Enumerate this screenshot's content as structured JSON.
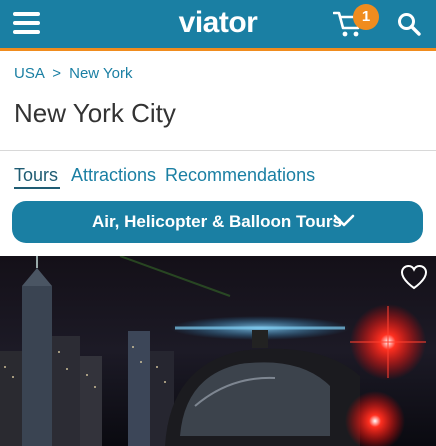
{
  "header": {
    "logo_text": "viator",
    "cart_count": "1",
    "brand_color": "#1a7fa3",
    "accent_color": "#f08c1e",
    "icons": [
      "hamburger-menu-icon",
      "cart-icon",
      "search-icon"
    ]
  },
  "breadcrumb": {
    "items": [
      "USA",
      "New York"
    ],
    "separator": ">"
  },
  "page": {
    "title": "New York City"
  },
  "tabs": [
    {
      "label": "Tours",
      "active": true
    },
    {
      "label": "Attractions",
      "active": false
    },
    {
      "label": "Recommendations",
      "active": false
    }
  ],
  "category": {
    "label": "Air, Helicopter & Balloon Tours",
    "icon": "chevron-down-icon"
  },
  "hero": {
    "favorite_icon": "heart-outline-icon"
  }
}
